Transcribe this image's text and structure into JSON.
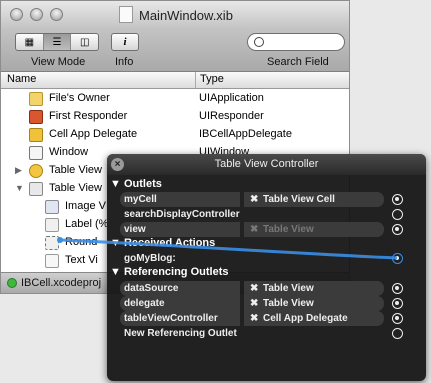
{
  "window": {
    "title": "MainWindow.xib",
    "toolbar": {
      "view_mode_label": "View Mode",
      "info_label": "Info",
      "info_glyph": "i",
      "search_label": "Search Field"
    },
    "columns": {
      "name": "Name",
      "type": "Type"
    },
    "rows": [
      {
        "name": "File's Owner",
        "type": "UIApplication"
      },
      {
        "name": "First Responder",
        "type": "UIResponder"
      },
      {
        "name": "Cell App Delegate",
        "type": "IBCellAppDelegate"
      },
      {
        "name": "Window",
        "type": "UIWindow"
      },
      {
        "name": "Table View",
        "type": ""
      },
      {
        "name": "Table View",
        "type": ""
      },
      {
        "name": "Image V",
        "type": ""
      },
      {
        "name": "Label (%",
        "type": ""
      },
      {
        "name": "Round",
        "type": ""
      },
      {
        "name": "Text Vi",
        "type": ""
      }
    ],
    "status": "IBCell.xcodeproj"
  },
  "hud": {
    "title": "Table View Controller",
    "outlets_header": "Outlets",
    "outlets": [
      {
        "name": "myCell",
        "target": "Table View Cell",
        "connected": true
      },
      {
        "name": "searchDisplayController",
        "target": "",
        "connected": false
      },
      {
        "name": "view",
        "target": "Table View",
        "connected": true,
        "dim": true
      }
    ],
    "actions_header": "Received Actions",
    "actions": [
      {
        "name": "goMyBlog:",
        "target": "",
        "connected": true
      }
    ],
    "ref_header": "Referencing Outlets",
    "ref_outlets": [
      {
        "name": "dataSource",
        "target": "Table View",
        "connected": true
      },
      {
        "name": "delegate",
        "target": "Table View",
        "connected": true
      },
      {
        "name": "tableViewController",
        "target": "Cell App Delegate",
        "connected": true
      },
      {
        "name": "New Referencing Outlet",
        "target": "",
        "connected": false
      }
    ]
  },
  "colors": {
    "wire": "#3a8ee6",
    "status_ok": "#3db93d"
  }
}
